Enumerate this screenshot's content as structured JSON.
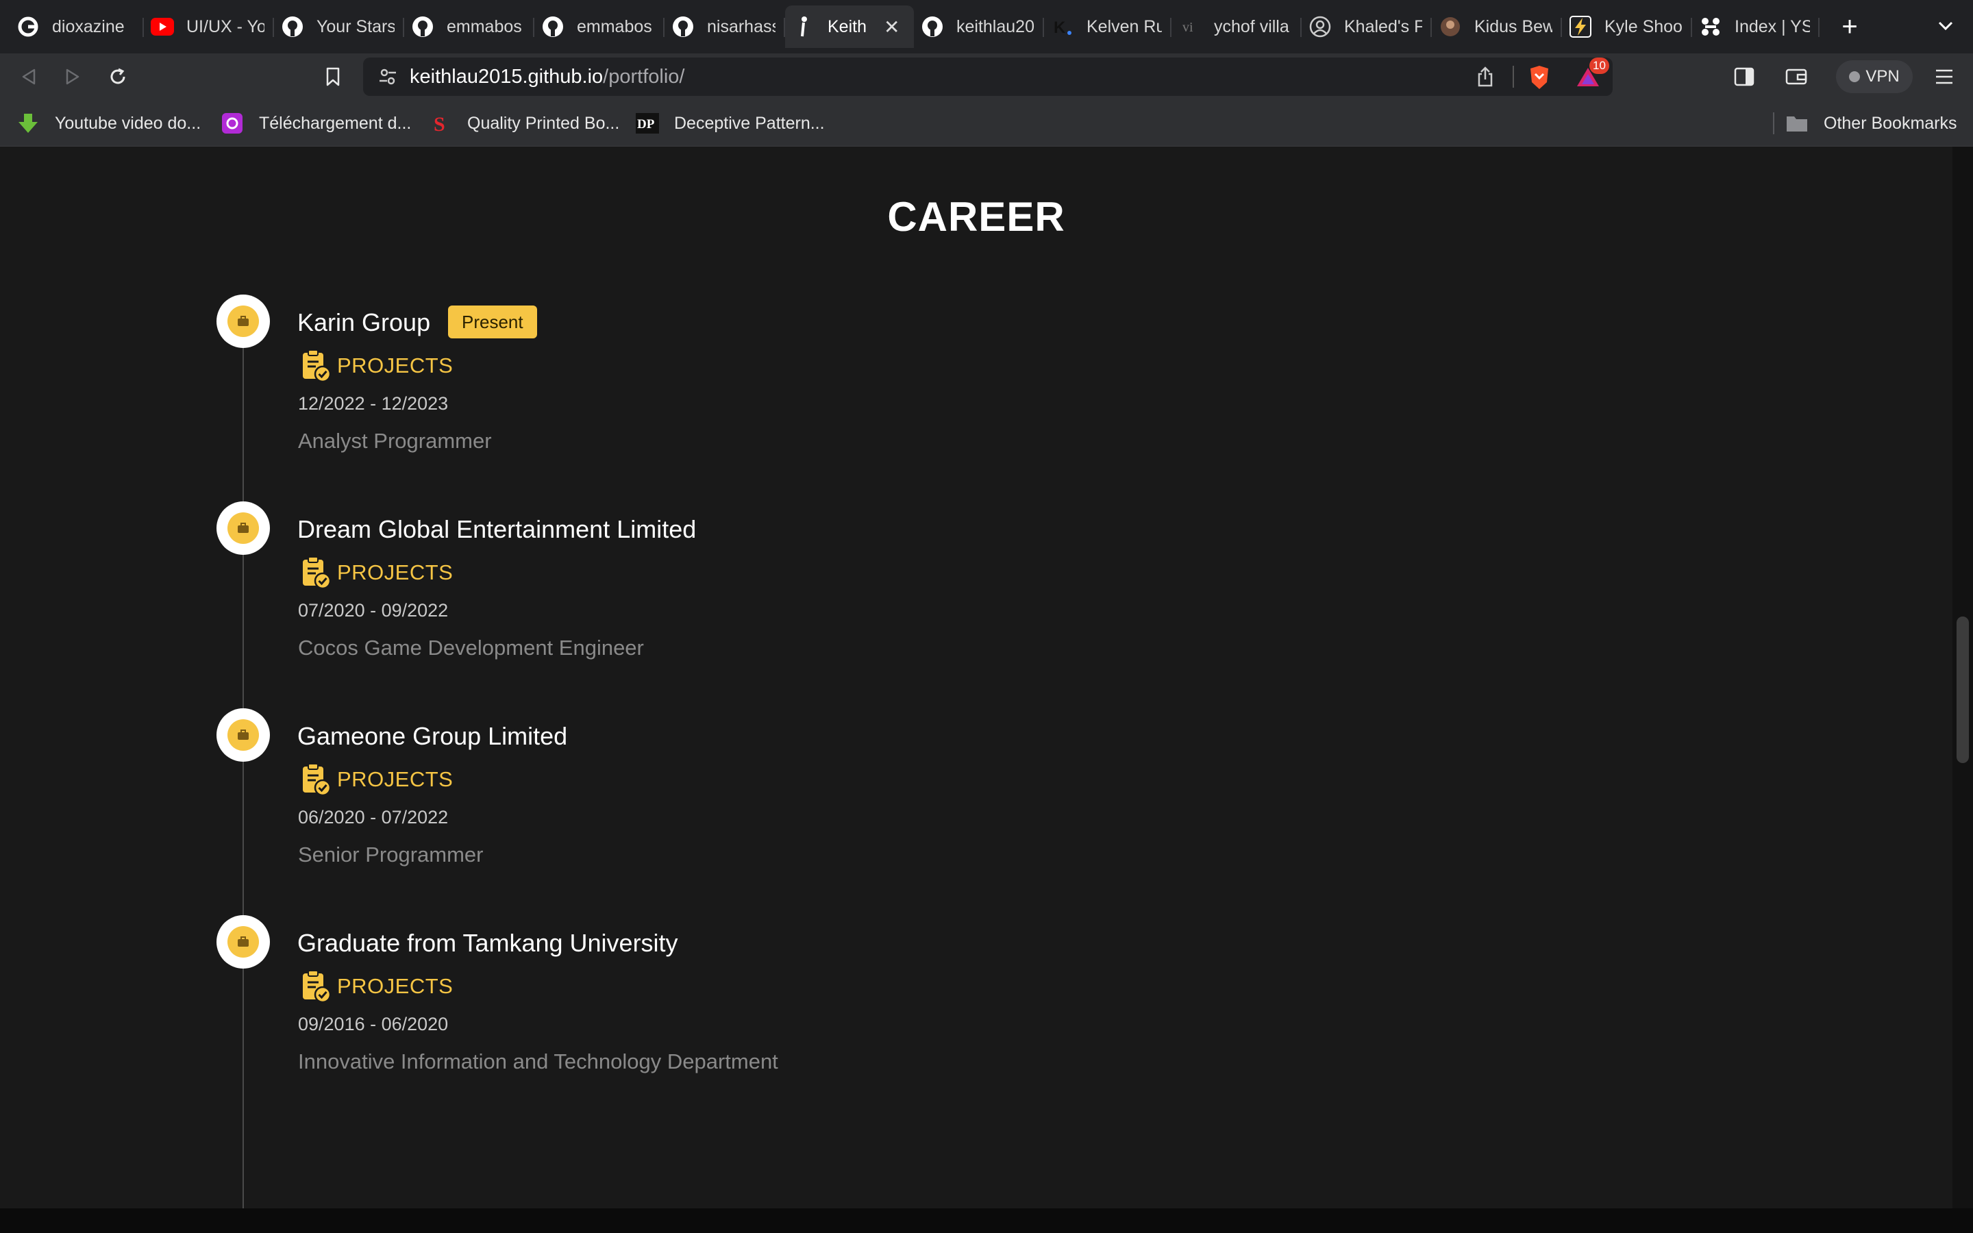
{
  "browser": {
    "tabs": [
      {
        "title": "dioxazine",
        "favicon": "google-icon"
      },
      {
        "title": "UI/UX - Yo",
        "favicon": "youtube-icon"
      },
      {
        "title": "Your Stars",
        "favicon": "github-icon"
      },
      {
        "title": "emmabos",
        "favicon": "github-icon"
      },
      {
        "title": "emmabos",
        "favicon": "github-icon"
      },
      {
        "title": "nisarhass",
        "favicon": "github-icon"
      },
      {
        "title": "Keith",
        "favicon": "figure-icon",
        "active": true
      },
      {
        "title": "keithlau20",
        "favicon": "github-icon"
      },
      {
        "title": "Kelven Ru",
        "favicon": "k-logo-icon"
      },
      {
        "title": "ychof villa",
        "favicon": "vi-logo-icon"
      },
      {
        "title": "Khaled's F",
        "favicon": "avatar-outline-icon"
      },
      {
        "title": "Kidus Bew",
        "favicon": "avatar-photo-icon"
      },
      {
        "title": "Kyle Shoo",
        "favicon": "bolt-icon"
      },
      {
        "title": "Index | YS",
        "favicon": "nodes-icon"
      }
    ],
    "url_host": "keithlau2015.github.io",
    "url_path": "/portfolio/",
    "shields_count": "10",
    "vpn_label": "VPN",
    "bookmarks": [
      {
        "label": "Youtube video do...",
        "icon": "download-arrow-icon"
      },
      {
        "label": "Téléchargement d...",
        "icon": "purple-square-icon"
      },
      {
        "label": "Quality Printed Bo...",
        "icon": "s-logo-icon"
      },
      {
        "label": "Deceptive Pattern...",
        "icon": "dp-logo-icon"
      }
    ],
    "other_bookmarks": "Other Bookmarks"
  },
  "career": {
    "title": "CAREER",
    "entries": [
      {
        "company": "Karin Group",
        "badge": "Present",
        "projects_label": "PROJECTS",
        "dates": "12/2022 - 12/2023",
        "role": "Analyst Programmer"
      },
      {
        "company": "Dream Global Entertainment Limited",
        "projects_label": "PROJECTS",
        "dates": "07/2020 - 09/2022",
        "role": "Cocos Game Development Engineer"
      },
      {
        "company": "Gameone Group Limited",
        "projects_label": "PROJECTS",
        "dates": "06/2020 - 07/2022",
        "role": "Senior Programmer"
      },
      {
        "company": "Graduate from Tamkang University",
        "projects_label": "PROJECTS",
        "dates": "09/2016 - 06/2020",
        "role": "Innovative Information and Technology Department"
      }
    ]
  },
  "colors": {
    "accent": "#f6c544",
    "background": "#191919",
    "chrome": "#2f3033"
  }
}
